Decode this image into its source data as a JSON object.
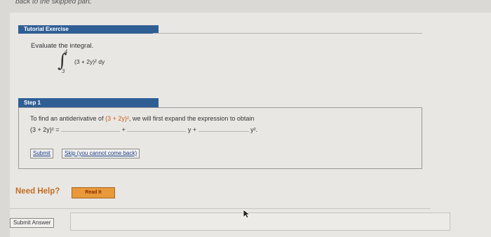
{
  "top_note": "back to the skipped part.",
  "tutorial": {
    "header": "Tutorial Exercise",
    "prompt": "Evaluate the integral.",
    "integral": {
      "upper": "4",
      "lower": "3",
      "integrand": "(3 + 2y)² dy"
    }
  },
  "step": {
    "header": "Step 1",
    "line1_a": "To find an antiderivative of ",
    "line1_expr": "(3 + 2y)²",
    "line1_b": ", we will first expand the expression to obtain",
    "line2_lhs": "(3 + 2y)² =",
    "plus1": "+",
    "y_plus": "y +",
    "y_sq": "y².",
    "submit_label": "Submit",
    "skip_label": "Skip (you cannot come back)"
  },
  "help": {
    "label": "Need Help?",
    "read_it": "Read It"
  },
  "footer": {
    "submit_answer": "Submit Answer"
  },
  "colors": {
    "header_bg": "#2f5e95",
    "accent": "#d05a12",
    "help": "#c46b22"
  }
}
